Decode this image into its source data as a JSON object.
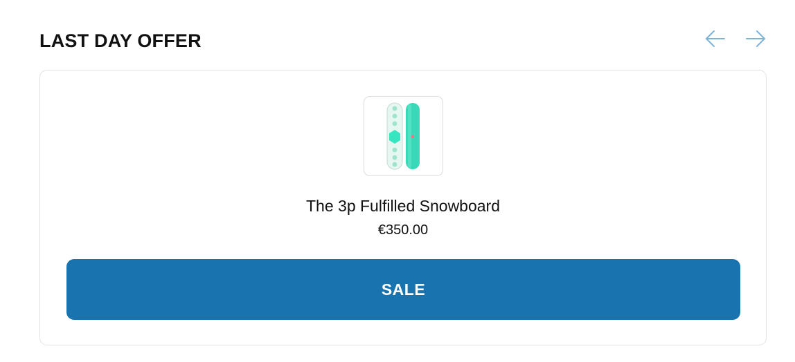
{
  "section": {
    "title": "LAST DAY OFFER",
    "nav": {
      "prev_icon": "arrow-left-icon",
      "next_icon": "arrow-right-icon"
    }
  },
  "product": {
    "image_icon": "snowboard-image",
    "title": "The 3p Fulfilled Snowboard",
    "price": "€350.00"
  },
  "cta": {
    "label": "SALE"
  },
  "colors": {
    "accent": "#1873ae",
    "arrow": "#7eb3d6",
    "border": "#e3e3e3"
  }
}
